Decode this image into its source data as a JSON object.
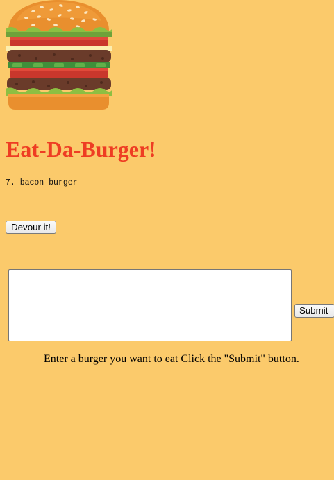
{
  "header": {
    "logo_icon": "burger-icon",
    "title": "Eat-Da-Burger!",
    "title_color": "#EE3D23"
  },
  "burgers": [
    {
      "id": 7,
      "name": "bacon burger",
      "label": "7. bacon burger"
    }
  ],
  "actions": {
    "devour_label": "Devour it!"
  },
  "form": {
    "textarea_value": "",
    "submit_label": "Submit",
    "instructions": "Enter a burger you want to eat Click the \"Submit\" button."
  },
  "colors": {
    "background": "#FBCA6B",
    "title": "#EE3D23"
  }
}
